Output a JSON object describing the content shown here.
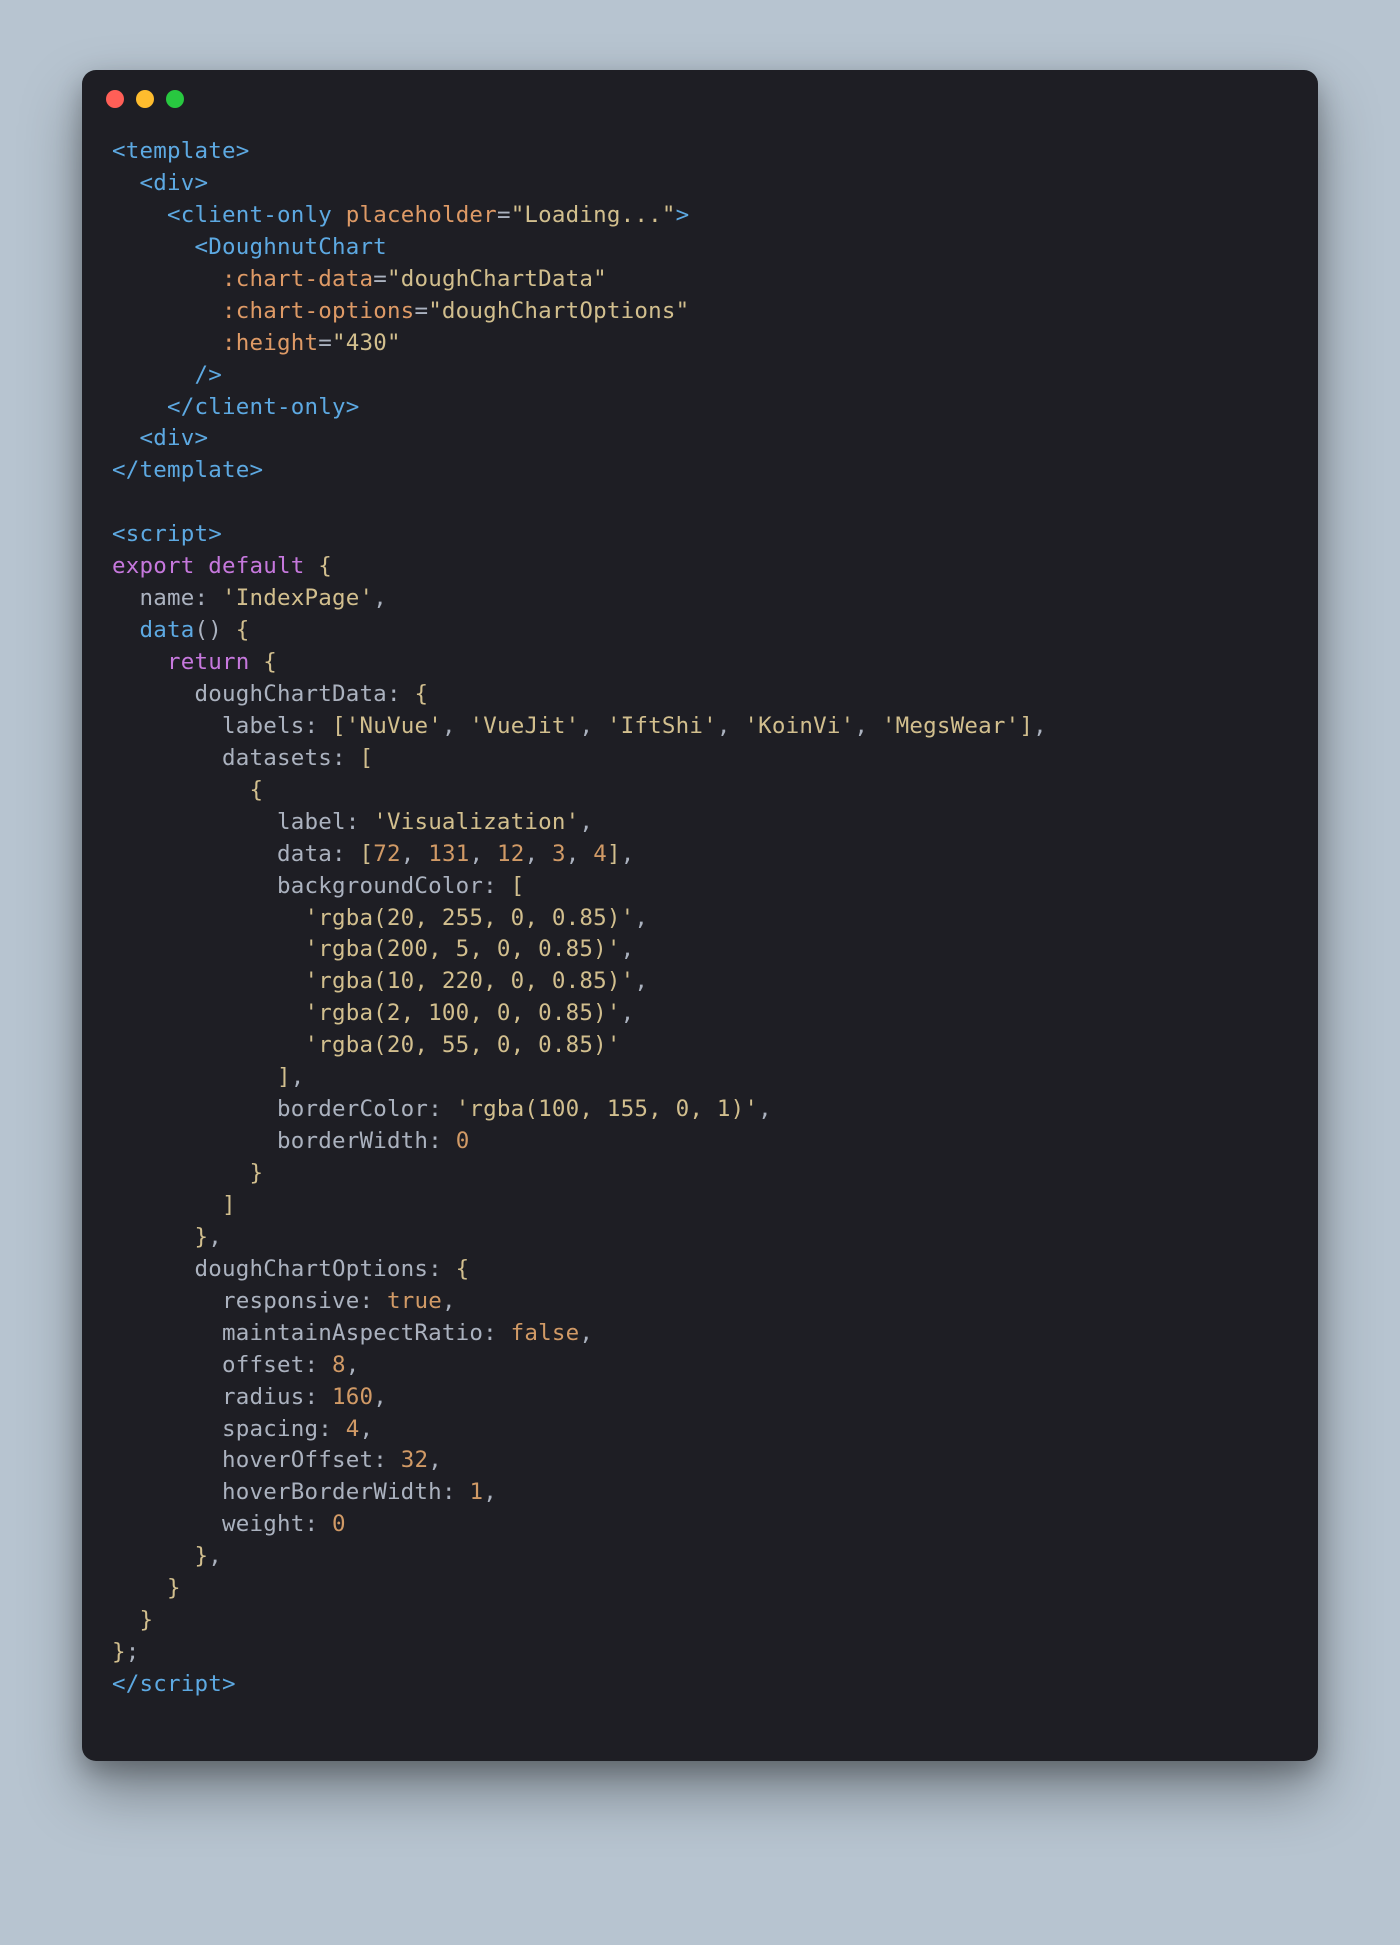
{
  "window": {
    "controls": [
      "close",
      "minimize",
      "maximize"
    ]
  },
  "code": {
    "tags": {
      "template_open": "<template>",
      "template_close": "</template>",
      "div_open": "<div>",
      "div_open2": "<div>",
      "client_only_open": "<client-only",
      "client_only_close": "</client-only>",
      "doughnut_open": "<DoughnutChart",
      "self_close": "/>",
      "gt": ">",
      "script_open": "<script>",
      "script_close": "</script>"
    },
    "attrs": {
      "placeholder": "placeholder",
      "chart_data": ":chart-data",
      "chart_options": ":chart-options",
      "height": ":height"
    },
    "values": {
      "placeholder": "\"Loading...\"",
      "chart_data": "\"doughChartData\"",
      "chart_options": "\"doughChartOptions\"",
      "height": "\"430\""
    },
    "js": {
      "export": "export",
      "default": "default",
      "name_key": "name",
      "name_val": "'IndexPage'",
      "data_fn": "data",
      "return": "return",
      "doughChartData": "doughChartData",
      "labels_key": "labels",
      "labels_arr": [
        "'NuVue'",
        "'VueJit'",
        "'IftShi'",
        "'KoinVi'",
        "'MegsWear'"
      ],
      "datasets_key": "datasets",
      "label_key": "label",
      "label_val": "'Visualization'",
      "data_key": "data",
      "data_arr": [
        "72",
        "131",
        "12",
        "3",
        "4"
      ],
      "bg_key": "backgroundColor",
      "bg_arr": [
        "'rgba(20, 255, 0, 0.85)'",
        "'rgba(200, 5, 0, 0.85)'",
        "'rgba(10, 220, 0, 0.85)'",
        "'rgba(2, 100, 0, 0.85)'",
        "'rgba(20, 55, 0, 0.85)'"
      ],
      "borderColor_key": "borderColor",
      "borderColor_val": "'rgba(100, 155, 0, 1)'",
      "borderWidth_key": "borderWidth",
      "borderWidth_val": "0",
      "doughChartOptions": "doughChartOptions",
      "responsive_key": "responsive",
      "responsive_val": "true",
      "maintainAR_key": "maintainAspectRatio",
      "maintainAR_val": "false",
      "offset_key": "offset",
      "offset_val": "8",
      "radius_key": "radius",
      "radius_val": "160",
      "spacing_key": "spacing",
      "spacing_val": "4",
      "hoverOffset_key": "hoverOffset",
      "hoverOffset_val": "32",
      "hoverBorderWidth_key": "hoverBorderWidth",
      "hoverBorderWidth_val": "1",
      "weight_key": "weight",
      "weight_val": "0"
    }
  }
}
